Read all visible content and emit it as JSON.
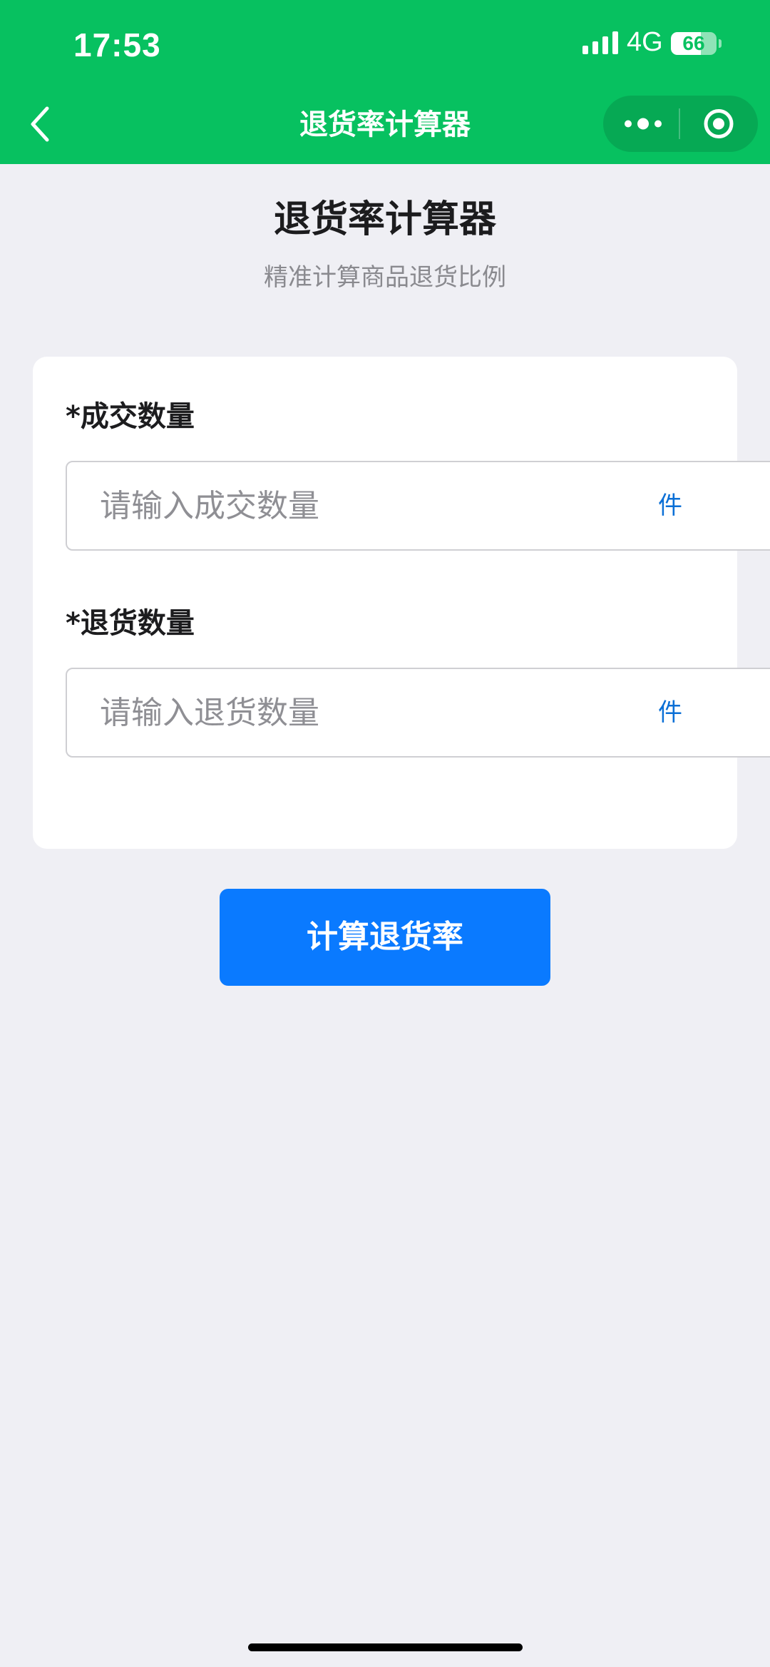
{
  "status_bar": {
    "time": "17:53",
    "network": "4G",
    "battery": "66",
    "battery_level": 0.66,
    "signal_icon": "cellular-signal-icon",
    "battery_icon": "battery-icon"
  },
  "nav_bar": {
    "title": "退货率计算器",
    "back_icon": "chevron-left-icon",
    "more_icon": "more-dots-icon",
    "close_icon": "target-circle-icon"
  },
  "page": {
    "title": "退货率计算器",
    "subtitle": "精准计算商品退货比例"
  },
  "form": {
    "fields": [
      {
        "required_mark": "*",
        "label": "成交数量",
        "value": "",
        "placeholder": "请输入成交数量",
        "unit": "件"
      },
      {
        "required_mark": "*",
        "label": "退货数量",
        "value": "",
        "placeholder": "请输入退货数量",
        "unit": "件"
      }
    ],
    "submit_label": "计算退货率"
  },
  "colors": {
    "header_bg": "#07c160",
    "page_bg": "#efeff4",
    "primary_button": "#0a7aff",
    "unit_text": "#0a6fd6"
  }
}
